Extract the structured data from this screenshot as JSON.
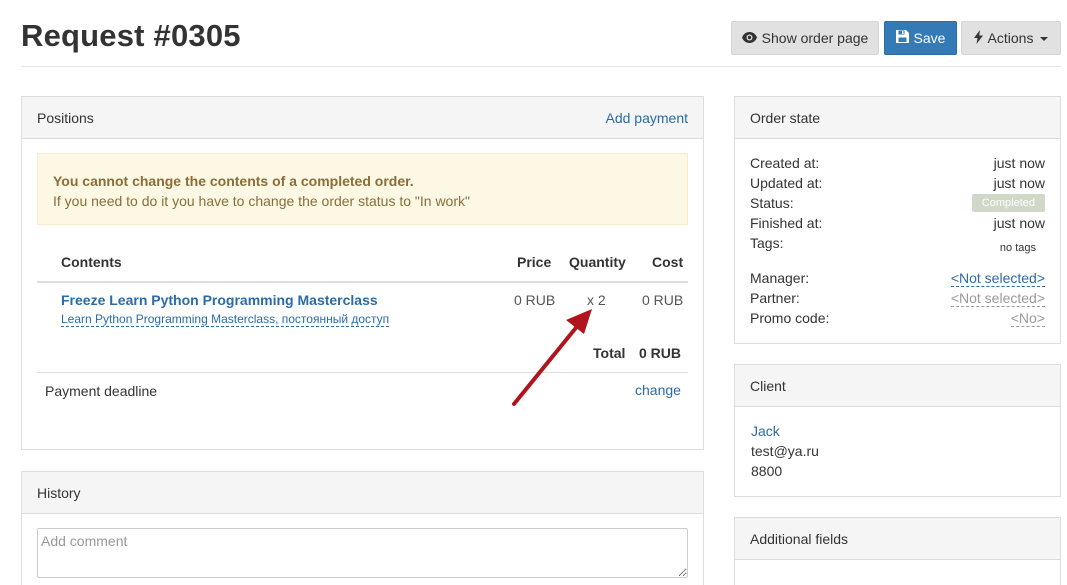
{
  "header": {
    "title": "Request #0305",
    "buttons": {
      "show_order": "Show order page",
      "save": "Save",
      "actions": "Actions"
    }
  },
  "positions": {
    "heading": "Positions",
    "add_payment": "Add payment",
    "alert": {
      "title": "You cannot change the contents of a completed order.",
      "text": "If you need to do it you have to change the order status to \"In work\""
    },
    "columns": {
      "contents": "Contents",
      "price": "Price",
      "quantity": "Quantity",
      "cost": "Cost"
    },
    "items": [
      {
        "title": "Freeze Learn Python Programming Masterclass",
        "subtitle": "Learn Python Programming Masterclass, постоянный доступ",
        "price": "0 RUB",
        "quantity": "x 2",
        "cost": "0 RUB"
      }
    ],
    "total_label": "Total",
    "total_value": "0 RUB",
    "payment_deadline_label": "Payment deadline",
    "payment_deadline_action": "change"
  },
  "history": {
    "heading": "History",
    "comment_placeholder": "Add comment"
  },
  "order_state": {
    "heading": "Order state",
    "created_label": "Created at:",
    "created_value": "just now",
    "updated_label": "Updated at:",
    "updated_value": "just now",
    "status_label": "Status:",
    "status_value": "Completed",
    "finished_label": "Finished at:",
    "finished_value": "just now",
    "tags_label": "Tags:",
    "tags_value": "no tags",
    "manager_label": "Manager:",
    "manager_value": "<Not selected>",
    "partner_label": "Partner:",
    "partner_value": "<Not selected>",
    "promo_label": "Promo code:",
    "promo_value": "<No>"
  },
  "client": {
    "heading": "Client",
    "name": "Jack",
    "email": "test@ya.ru",
    "phone": "8800"
  },
  "additional_fields": {
    "heading": "Additional fields"
  },
  "colors": {
    "primary": "#337ab7",
    "link": "#2a6ba8",
    "alert_bg": "#fcf8e3",
    "alert_text": "#8a6d3b",
    "annotation_arrow": "#b0141c"
  }
}
